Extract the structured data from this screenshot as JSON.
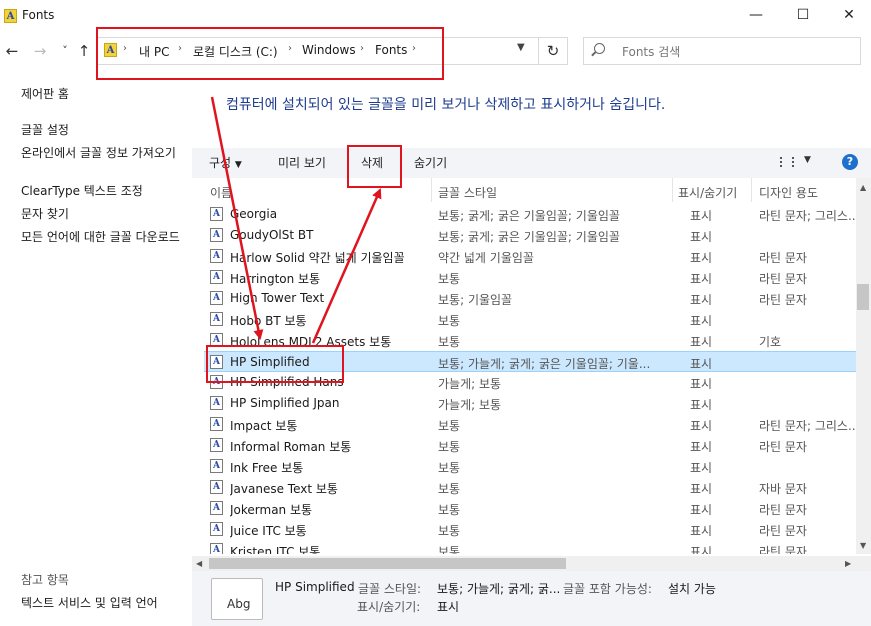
{
  "window": {
    "title": "Fonts",
    "controls": [
      "—",
      "☐",
      "✕"
    ]
  },
  "nav": {
    "back": "←",
    "forward": "→",
    "recent": "˅",
    "up": "↑",
    "breadcrumbs": [
      "내 PC",
      "로컬 디스크 (C:)",
      "Windows",
      "Fonts"
    ],
    "refresh": "↻",
    "search_placeholder": "Fonts 검색"
  },
  "sidebar": {
    "home": "제어판 홈",
    "links": [
      "글꼴 설정",
      "온라인에서 글꼴 정보 가져오기",
      "ClearType 텍스트 조정",
      "문자 찾기",
      "모든 언어에 대한 글꼴 다운로드"
    ],
    "see_also_title": "참고 항목",
    "see_also": [
      "텍스트 서비스 및 입력 언어"
    ]
  },
  "headline": "컴퓨터에 설치되어 있는 글꼴을 미리 보거나 삭제하고 표시하거나 숨깁니다.",
  "toolbar": {
    "organize": "구성",
    "preview": "미리 보기",
    "delete": "삭제",
    "hide": "숨기기",
    "help": "?"
  },
  "columns": {
    "name": "이름",
    "style": "글꼴 스타일",
    "show": "표시/숨기기",
    "designed": "디자인 용도"
  },
  "rows": [
    {
      "name": "Georgia",
      "style": "보통; 굵게; 굵은 기울임꼴; 기울임꼴",
      "show": "표시",
      "designed": "라틴 문자; 그리스..."
    },
    {
      "name": "GoudyOlSt BT",
      "style": "보통; 굵게; 굵은 기울임꼴; 기울임꼴",
      "show": "표시",
      "designed": ""
    },
    {
      "name": "Harlow Solid 약간 넓게 기울임꼴",
      "style": "약간 넓게 기울임꼴",
      "show": "표시",
      "designed": "라틴 문자"
    },
    {
      "name": "Harrington 보통",
      "style": "보통",
      "show": "표시",
      "designed": "라틴 문자"
    },
    {
      "name": "High Tower Text",
      "style": "보통; 기울임꼴",
      "show": "표시",
      "designed": "라틴 문자"
    },
    {
      "name": "Hobo BT 보통",
      "style": "보통",
      "show": "표시",
      "designed": ""
    },
    {
      "name": "HoloLens MDL2 Assets 보통",
      "style": "보통",
      "show": "표시",
      "designed": "기호"
    },
    {
      "name": "HP Simplified",
      "style": "보통; 가늘게; 굵게; 굵은 기울임꼴; 기울...",
      "show": "표시",
      "designed": "",
      "selected": true
    },
    {
      "name": "HP Simplified Hans",
      "style": "가늘게; 보통",
      "show": "표시",
      "designed": ""
    },
    {
      "name": "HP Simplified Jpan",
      "style": "가늘게; 보통",
      "show": "표시",
      "designed": ""
    },
    {
      "name": "Impact 보통",
      "style": "보통",
      "show": "표시",
      "designed": "라틴 문자; 그리스..."
    },
    {
      "name": "Informal Roman 보통",
      "style": "보통",
      "show": "표시",
      "designed": "라틴 문자"
    },
    {
      "name": "Ink Free 보통",
      "style": "보통",
      "show": "표시",
      "designed": ""
    },
    {
      "name": "Javanese Text 보통",
      "style": "보통",
      "show": "표시",
      "designed": "자바 문자"
    },
    {
      "name": "Jokerman 보통",
      "style": "보통",
      "show": "표시",
      "designed": "라틴 문자"
    },
    {
      "name": "Juice ITC 보통",
      "style": "보통",
      "show": "표시",
      "designed": "라틴 문자"
    },
    {
      "name": "Kristen ITC 보통",
      "style": "보통",
      "show": "표시",
      "designed": "라틴 문자"
    }
  ],
  "details": {
    "name": "HP Simplified",
    "style_label": "글꼴 스타일:",
    "style_value": "보통; 가늘게; 굵게; 굵...",
    "embed_label": "글꼴 포함 가능성:",
    "embed_value": "설치 가능",
    "show_label": "표시/숨기기:",
    "show_value": "표시",
    "icon_text": "Abg"
  },
  "colors": {
    "annotation_red": "#e0141e",
    "selection": "#cce8ff",
    "link_blue": "#1e3d8f"
  }
}
